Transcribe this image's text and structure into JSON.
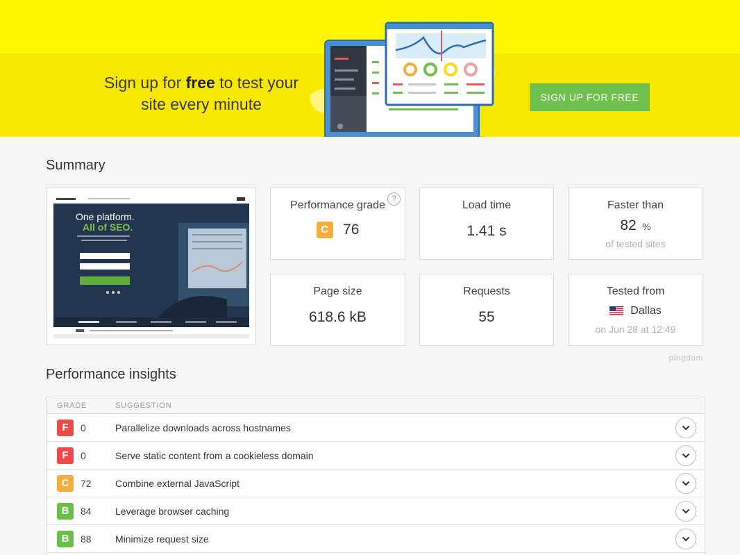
{
  "banner": {
    "headline_pre": "Sign up for ",
    "headline_bold": "free",
    "headline_post": " to test your site every minute",
    "cta_label": "SIGN UP FOR FREE"
  },
  "summary": {
    "title": "Summary",
    "screenshot": {
      "brand": "Link-Assistant.Com",
      "headline_1": "One platform.",
      "headline_2": "All of SEO.",
      "tagline": "Rankings, on-page, backlinks, and reports all in one easy-to-use toolkit.",
      "name_placeholder": "Name",
      "email_placeholder": "Email",
      "download_label": "DOWNLOAD FOR FREE",
      "suite_label": "SEO PowerSuite"
    },
    "performance": {
      "label": "Performance grade",
      "grade": "C",
      "score": "76",
      "grade_color": "#f5ad3c",
      "help": "?"
    },
    "load_time": {
      "label": "Load time",
      "value": "1.41 s"
    },
    "faster_than": {
      "label": "Faster than",
      "value": "82",
      "unit": "%",
      "sub": "of tested sites"
    },
    "page_size": {
      "label": "Page size",
      "value": "618.6 kB"
    },
    "requests": {
      "label": "Requests",
      "value": "55"
    },
    "tested_from": {
      "label": "Tested from",
      "location": "Dallas",
      "date": "on Jun 28 at 12:49"
    },
    "brand": "pingdom"
  },
  "insights": {
    "title": "Performance insights",
    "headers": {
      "grade": "GRADE",
      "suggestion": "SUGGESTION"
    },
    "rows": [
      {
        "grade": "F",
        "score": "0",
        "suggestion": "Parallelize downloads across hostnames",
        "color": "#f0494a"
      },
      {
        "grade": "F",
        "score": "0",
        "suggestion": "Serve static content from a cookieless domain",
        "color": "#f0494a"
      },
      {
        "grade": "C",
        "score": "72",
        "suggestion": "Combine external JavaScript",
        "color": "#f5ad3c"
      },
      {
        "grade": "B",
        "score": "84",
        "suggestion": "Leverage browser caching",
        "color": "#6abf4b"
      },
      {
        "grade": "B",
        "score": "88",
        "suggestion": "Minimize request size",
        "color": "#6abf4b"
      }
    ]
  },
  "colors": {
    "banner": "#fff200",
    "cta": "#6fc04d",
    "grade_f": "#f0494a",
    "grade_c": "#f5ad3c",
    "grade_b": "#6abf4b"
  },
  "icons": {
    "help": "question-circle-icon",
    "expand": "chevron-down-icon",
    "flag": "us-flag-icon"
  }
}
